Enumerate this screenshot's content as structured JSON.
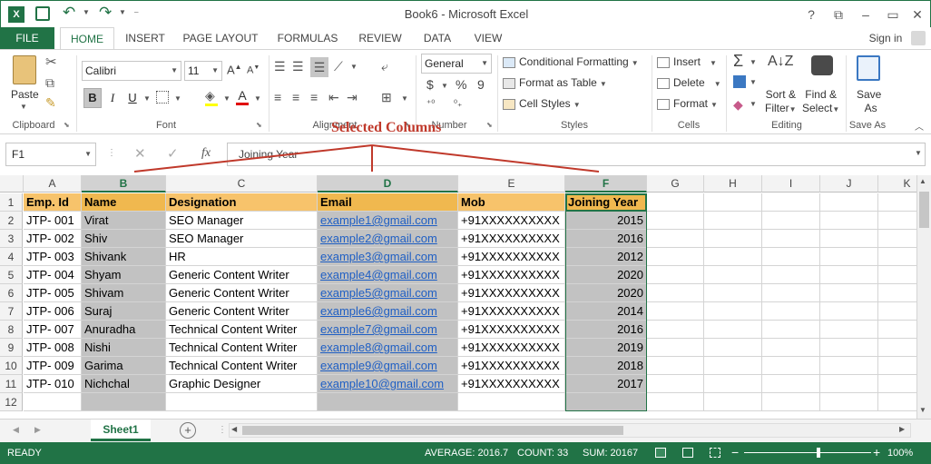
{
  "window": {
    "title": "Book6 - Microsoft Excel",
    "help": "?",
    "minimize": "–",
    "restore": "▭",
    "close": "✕",
    "ribbon_display": "⧉"
  },
  "qat": {
    "save_icon": "save-icon",
    "undo_icon": "undo-icon",
    "redo_icon": "redo-icon"
  },
  "tabs": [
    "FILE",
    "HOME",
    "INSERT",
    "PAGE LAYOUT",
    "FORMULAS",
    "REVIEW",
    "DATA",
    "VIEW"
  ],
  "sign_in": "Sign in",
  "ribbon": {
    "clipboard": {
      "paste": "Paste",
      "label": "Clipboard"
    },
    "font": {
      "name": "Calibri",
      "size": "11",
      "bold": "B",
      "italic": "I",
      "underline": "U",
      "label": "Font"
    },
    "alignment": {
      "label": "Alignment"
    },
    "number": {
      "format": "General",
      "currency": "$",
      "percent": "%",
      "comma": "9",
      "label": "Number"
    },
    "styles": {
      "conditional": "Conditional Formatting",
      "format_table": "Format as Table",
      "cell_styles": "Cell Styles",
      "label": "Styles"
    },
    "cells": {
      "insert": "Insert",
      "delete": "Delete",
      "format": "Format",
      "label": "Cells"
    },
    "editing": {
      "sum": "Σ",
      "sort": "Sort &",
      "sort2": "Filter",
      "find": "Find &",
      "find2": "Select",
      "label": "Editing"
    },
    "save": {
      "label1": "Save",
      "label2": "As",
      "group": "Save As"
    }
  },
  "formula_bar": {
    "name_box": "F1",
    "fx": "fx",
    "value": "Joining Year"
  },
  "annotation": "Selected Columns",
  "columns": [
    "A",
    "B",
    "C",
    "D",
    "E",
    "F",
    "G",
    "H",
    "I",
    "J",
    "K"
  ],
  "selected_columns": [
    "B",
    "D",
    "F"
  ],
  "headers": [
    "Emp. Id",
    "Name",
    "Designation",
    "Email",
    "Mob",
    "Joining Year"
  ],
  "rows": [
    [
      "JTP- 001",
      "Virat",
      "SEO Manager",
      "example1@gmail.com",
      "+91XXXXXXXXXX",
      "2015"
    ],
    [
      "JTP- 002",
      "Shiv",
      "SEO Manager",
      "example2@gmail.com",
      "+91XXXXXXXXXX",
      "2016"
    ],
    [
      "JTP- 003",
      "Shivank",
      "HR",
      "example3@gmail.com",
      "+91XXXXXXXXXX",
      "2012"
    ],
    [
      "JTP- 004",
      "Shyam",
      "Generic Content Writer",
      "example4@gmail.com",
      "+91XXXXXXXXXX",
      "2020"
    ],
    [
      "JTP- 005",
      "Shivam",
      "Generic Content Writer",
      "example5@gmail.com",
      "+91XXXXXXXXXX",
      "2020"
    ],
    [
      "JTP- 006",
      "Suraj",
      "Generic Content Writer",
      "example6@gmail.com",
      "+91XXXXXXXXXX",
      "2014"
    ],
    [
      "JTP- 007",
      "Anuradha",
      "Technical Content Writer",
      "example7@gmail.com",
      "+91XXXXXXXXXX",
      "2016"
    ],
    [
      "JTP- 008",
      "Nishi",
      "Technical Content Writer",
      "example8@gmail.com",
      "+91XXXXXXXXXX",
      "2019"
    ],
    [
      "JTP- 009",
      "Garima",
      "Technical Content Writer",
      "example9@gmail.com",
      "+91XXXXXXXXXX",
      "2018"
    ],
    [
      "JTP- 010",
      "Nichchal",
      "Graphic Designer",
      "example10@gmail.com",
      "+91XXXXXXXXXX",
      "2017"
    ]
  ],
  "row_numbers": [
    "1",
    "2",
    "3",
    "4",
    "5",
    "6",
    "7",
    "8",
    "9",
    "10",
    "11",
    "12"
  ],
  "sheet": {
    "name": "Sheet1",
    "add": "+"
  },
  "status": {
    "ready": "READY",
    "average": "AVERAGE: 2016.7",
    "count": "COUNT: 33",
    "sum": "SUM: 20167",
    "zoom": "100%",
    "minus": "−",
    "plus": "+"
  },
  "colors": {
    "excel_green": "#217346",
    "header_fill": "#f7c36b",
    "selection": "#c2c2c2",
    "annotation": "#c0392b"
  }
}
